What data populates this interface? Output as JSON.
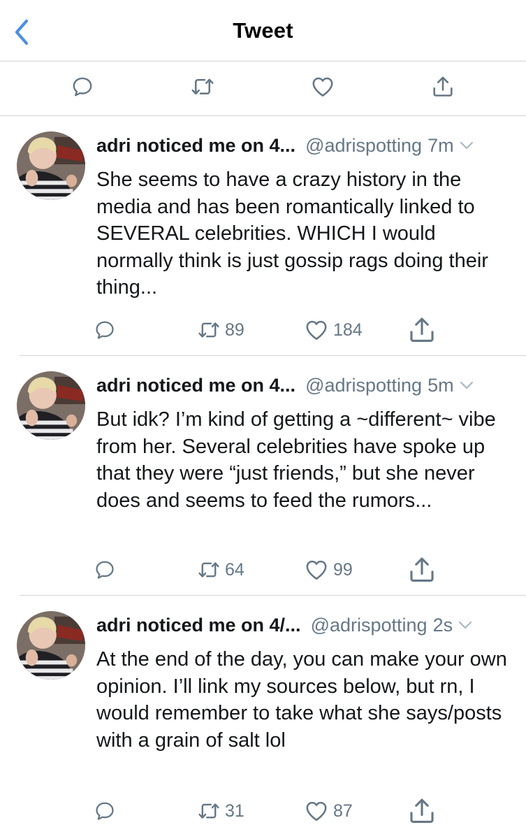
{
  "header": {
    "title": "Tweet"
  },
  "colors": {
    "accent": "#4a90e2",
    "icon_gray": "#657786",
    "divider": "#d0d4d8"
  },
  "action_bar": {
    "icons": [
      "reply-icon",
      "retweet-icon",
      "like-icon",
      "share-icon"
    ]
  },
  "tweets": [
    {
      "name": "adri noticed me on 4...",
      "handle": "@adrispotting",
      "time": "7m",
      "text": "She seems to have a crazy history in the media and has been romantically linked to SEVERAL celebrities. WHICH I would normally think is just gossip rags doing their thing...",
      "retweets": "89",
      "likes": "184"
    },
    {
      "name": "adri noticed me on 4...",
      "handle": "@adrispotting",
      "time": "5m",
      "text": "But idk? I’m kind of getting a ~different~ vibe from her. Several celebrities have spoke up that they were “just friends,” but she never does and seems to feed the rumors...",
      "retweets": "64",
      "likes": "99"
    },
    {
      "name": "adri noticed me on 4/...",
      "handle": "@adrispotting",
      "time": "2s",
      "text": "At the end of the day, you can make your own opinion. I’ll link my sources below, but rn, I would remember to take what she says/posts with a grain of salt lol",
      "retweets": "31",
      "likes": "87"
    }
  ]
}
